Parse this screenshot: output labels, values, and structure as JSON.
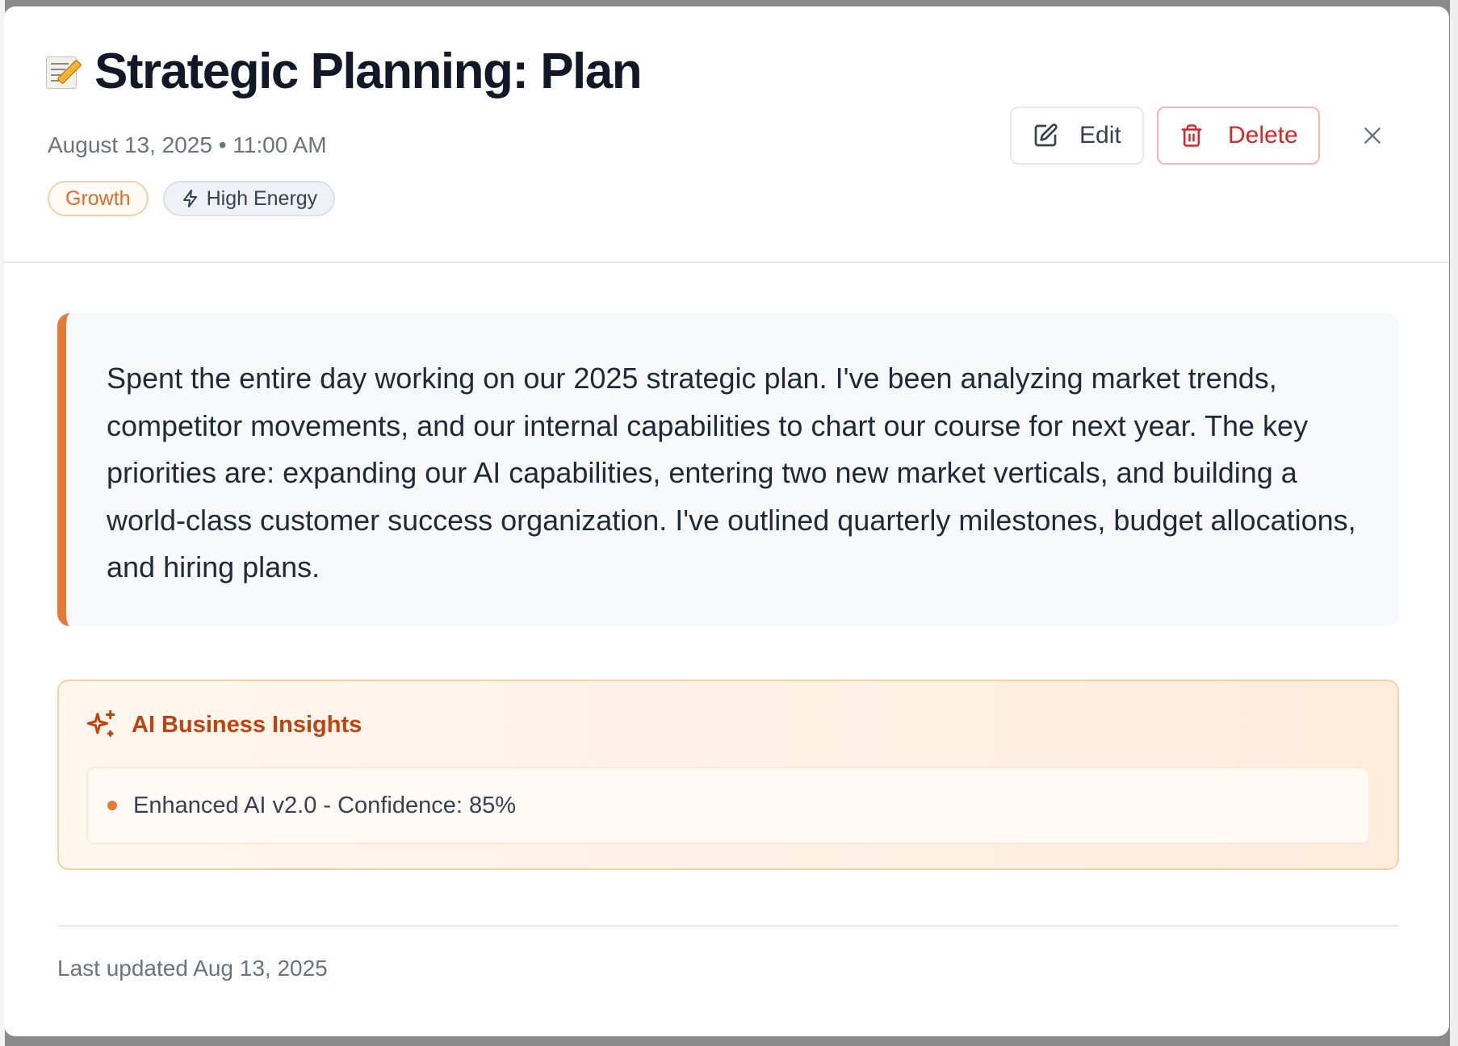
{
  "entry": {
    "emoji": "memo-icon",
    "title": "Strategic Planning: Plan",
    "datetime": "August 13, 2025 • 11:00 AM",
    "tags": {
      "category": "Growth",
      "energy": "High Energy"
    },
    "content": "Spent the entire day working on our 2025 strategic plan. I've been analyzing market trends, competitor movements, and our internal capabilities to chart our course for next year. The key priorities are: expanding our AI capabilities, entering two new market verticals, and building a world-class customer success organization. I've outlined quarterly milestones, budget allocations, and hiring plans."
  },
  "actions": {
    "edit_label": "Edit",
    "delete_label": "Delete"
  },
  "insights": {
    "title": "AI Business Insights",
    "items": [
      "Enhanced AI v2.0 - Confidence: 85%"
    ]
  },
  "footer": {
    "last_updated": "Last updated Aug 13, 2025"
  },
  "colors": {
    "accent": "#e47a35",
    "danger": "#dc2626",
    "insight_title": "#c2410c",
    "title": "#111827"
  },
  "icons": {
    "edit": "pencil-square-icon",
    "delete": "trash-icon",
    "close": "close-icon",
    "energy": "lightning-icon",
    "insights": "sparkles-icon"
  }
}
